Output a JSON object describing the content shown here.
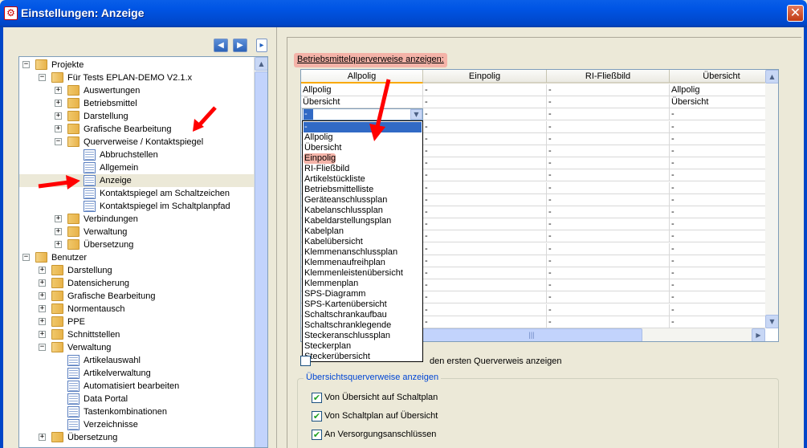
{
  "window": {
    "title": "Einstellungen: Anzeige",
    "icon": "eplan-settings-icon",
    "close_label": "✕"
  },
  "toolbar": {
    "back_icon": "back-arrow-icon",
    "forward_icon": "forward-arrow-icon",
    "collapse_icon": "collapse-panel-icon"
  },
  "tree": {
    "items": [
      {
        "label": "Projekte",
        "level": 0,
        "icon": "folder",
        "expanded": true
      },
      {
        "label": "Für Tests EPLAN-DEMO V2.1.x",
        "level": 1,
        "icon": "folder",
        "expanded": true
      },
      {
        "label": "Auswertungen",
        "level": 2,
        "icon": "folder",
        "expanded": false
      },
      {
        "label": "Betriebsmittel",
        "level": 2,
        "icon": "folder",
        "expanded": false
      },
      {
        "label": "Darstellung",
        "level": 2,
        "icon": "folder",
        "expanded": false
      },
      {
        "label": "Grafische Bearbeitung",
        "level": 2,
        "icon": "folder",
        "expanded": false
      },
      {
        "label": "Querverweise / Kontaktspiegel",
        "level": 2,
        "icon": "folder",
        "expanded": true
      },
      {
        "label": "Abbruchstellen",
        "level": 3,
        "icon": "page"
      },
      {
        "label": "Allgemein",
        "level": 3,
        "icon": "page"
      },
      {
        "label": "Anzeige",
        "level": 3,
        "icon": "page",
        "selected": true
      },
      {
        "label": "Kontaktspiegel am Schaltzeichen",
        "level": 3,
        "icon": "page"
      },
      {
        "label": "Kontaktspiegel im Schaltplanpfad",
        "level": 3,
        "icon": "page"
      },
      {
        "label": "Verbindungen",
        "level": 2,
        "icon": "folder",
        "expanded": false
      },
      {
        "label": "Verwaltung",
        "level": 2,
        "icon": "folder",
        "expanded": false
      },
      {
        "label": "Übersetzung",
        "level": 2,
        "icon": "folder",
        "expanded": false
      },
      {
        "label": "Benutzer",
        "level": 0,
        "icon": "folder",
        "expanded": true
      },
      {
        "label": "Darstellung",
        "level": 1,
        "icon": "folder",
        "expanded": false
      },
      {
        "label": "Datensicherung",
        "level": 1,
        "icon": "folder",
        "expanded": false
      },
      {
        "label": "Grafische Bearbeitung",
        "level": 1,
        "icon": "folder",
        "expanded": false
      },
      {
        "label": "Normentausch",
        "level": 1,
        "icon": "folder",
        "expanded": false
      },
      {
        "label": "PPE",
        "level": 1,
        "icon": "folder",
        "expanded": false
      },
      {
        "label": "Schnittstellen",
        "level": 1,
        "icon": "folder",
        "expanded": false
      },
      {
        "label": "Verwaltung",
        "level": 1,
        "icon": "folder",
        "expanded": true
      },
      {
        "label": "Artikelauswahl",
        "level": 2,
        "icon": "page"
      },
      {
        "label": "Artikelverwaltung",
        "level": 2,
        "icon": "page"
      },
      {
        "label": "Automatisiert bearbeiten",
        "level": 2,
        "icon": "page"
      },
      {
        "label": "Data Portal",
        "level": 2,
        "icon": "page"
      },
      {
        "label": "Tastenkombinationen",
        "level": 2,
        "icon": "page"
      },
      {
        "label": "Verzeichnisse",
        "level": 2,
        "icon": "page"
      },
      {
        "label": "Übersetzung",
        "level": 1,
        "icon": "folder",
        "expanded": false
      }
    ]
  },
  "panel": {
    "section_label": "Betriebsmittelquerverweise anzeigen:",
    "grid": {
      "columns": [
        "Allpolig",
        "Einpolig",
        "RI-Fließbild",
        "Übersicht"
      ],
      "rows": [
        [
          "Allpolig",
          "-",
          "-",
          "Allpolig"
        ],
        [
          "Übersicht",
          "-",
          "-",
          "Übersicht"
        ],
        [
          "-",
          "-",
          "-",
          "-"
        ],
        [
          "",
          "-",
          "-",
          "-"
        ],
        [
          "",
          "-",
          "-",
          "-"
        ],
        [
          "",
          "-",
          "-",
          "-"
        ],
        [
          "",
          "-",
          "-",
          "-"
        ],
        [
          "",
          "-",
          "-",
          "-"
        ],
        [
          "",
          "-",
          "-",
          "-"
        ],
        [
          "",
          "-",
          "-",
          "-"
        ],
        [
          "",
          "-",
          "-",
          "-"
        ],
        [
          "",
          "-",
          "-",
          "-"
        ],
        [
          "",
          "-",
          "-",
          "-"
        ],
        [
          "",
          "-",
          "-",
          "-"
        ],
        [
          "",
          "-",
          "-",
          "-"
        ],
        [
          "",
          "-",
          "-",
          "-"
        ],
        [
          "",
          "-",
          "-",
          "-"
        ],
        [
          "",
          "-",
          "-",
          "-"
        ],
        [
          "",
          "-",
          "-",
          "-"
        ],
        [
          "",
          "-",
          "-",
          "-"
        ]
      ]
    },
    "combo_value": "-",
    "dropdown_options": [
      "-",
      "Allpolig",
      "Übersicht",
      "Einpolig",
      "RI-Fließbild",
      "Artikelstückliste",
      "Betriebsmittelliste",
      "Geräteanschlussplan",
      "Kabelanschlussplan",
      "Kabeldarstellungsplan",
      "Kabelplan",
      "Kabelübersicht",
      "Klemmenanschlussplan",
      "Klemmenaufreihplan",
      "Klemmenleistenübersicht",
      "Klemmenplan",
      "SPS-Diagramm",
      "SPS-Kartenübersicht",
      "Schaltschrankaufbau",
      "Schaltschranklegende",
      "Steckeranschlussplan",
      "Steckerplan",
      "Steckerübersicht"
    ],
    "dropdown_selected_index": 0,
    "dropdown_highlight_index": 3,
    "partial_checkbox_label": "den ersten Querverweis anzeigen",
    "overview_group": {
      "title": "Übersichtsquerverweise anzeigen",
      "checkboxes": [
        {
          "label": "Von Übersicht auf Schaltplan",
          "checked": true
        },
        {
          "label": "Von Schaltplan auf Übersicht",
          "checked": true
        },
        {
          "label": "An Versorgungsanschlüssen",
          "checked": true
        }
      ]
    }
  },
  "colors": {
    "title_bar": "#0055e5",
    "annotation_arrow": "#ff0000",
    "highlight": "#f4b3a8",
    "selection": "#316ac5"
  }
}
